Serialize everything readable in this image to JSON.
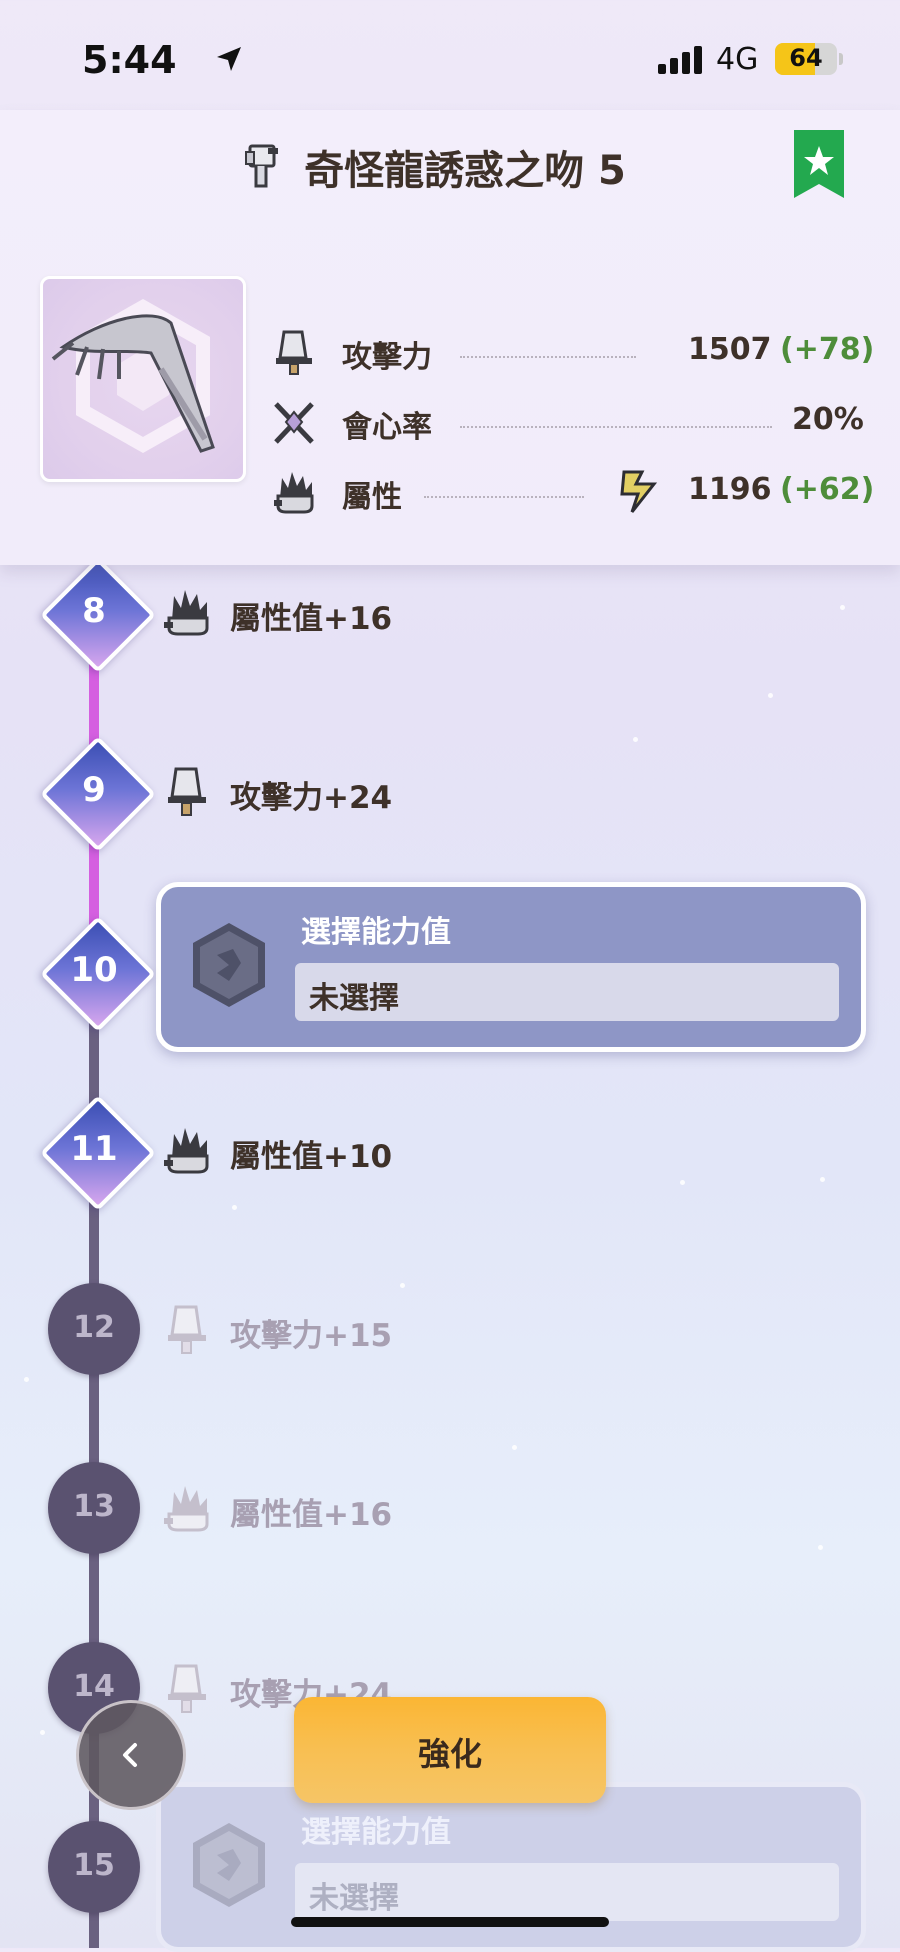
{
  "status_bar": {
    "time": "5:44",
    "network": "4G",
    "battery": "64"
  },
  "header": {
    "title": "奇怪龍誘惑之吻 5",
    "weapon_type_icon": "gunlance-icon",
    "favorite_icon": "bookmark-star-icon",
    "stats": {
      "attack": {
        "label": "攻擊力",
        "value": "1507",
        "bonus": "(+78)"
      },
      "affinity": {
        "label": "會心率",
        "value": "20%"
      },
      "element": {
        "label": "屬性",
        "value": "1196",
        "bonus": "(+62)",
        "element_icon": "thunder-icon"
      }
    }
  },
  "upgrades": [
    {
      "level": "8",
      "label": "屬性值+16",
      "icon": "element-icon",
      "state": "done"
    },
    {
      "level": "9",
      "label": "攻擊力+24",
      "icon": "attack-icon",
      "state": "done"
    },
    {
      "level": "10",
      "label": "選擇能力值",
      "select_value": "未選擇",
      "icon": "hex-select-icon",
      "state": "selecting"
    },
    {
      "level": "11",
      "label": "屬性值+10",
      "icon": "element-icon",
      "state": "done"
    },
    {
      "level": "12",
      "label": "攻擊力+15",
      "icon": "attack-icon",
      "state": "locked"
    },
    {
      "level": "13",
      "label": "屬性值+16",
      "icon": "element-icon",
      "state": "locked"
    },
    {
      "level": "14",
      "label": "攻擊力+24",
      "icon": "attack-icon",
      "state": "locked"
    },
    {
      "level": "15",
      "label": "選擇能力值",
      "select_value": "未選擇",
      "icon": "hex-select-icon",
      "state": "locked"
    }
  ],
  "actions": {
    "back_icon": "chevron-left-icon",
    "enhance_label": "強化"
  },
  "colors": {
    "progress_line": "#d55fe0",
    "locked_line": "#6a6180",
    "bonus_green": "#4e8d3a",
    "enhance_button": "#fbb634",
    "select_card": "#8e96c6"
  }
}
